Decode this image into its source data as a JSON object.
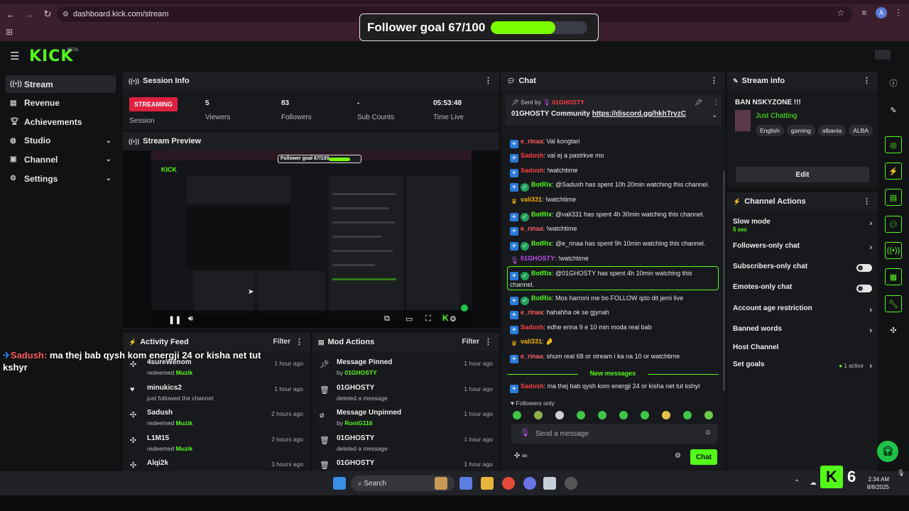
{
  "browser": {
    "url": "dashboard.kick.com/stream",
    "profile_initial": "A"
  },
  "goal": {
    "text": "Follower goal 67/100",
    "progress": 0.67
  },
  "brand": {
    "logo": "KICK",
    "badge": "BETA",
    "accent": "#53fc18"
  },
  "sidebar": {
    "items": [
      {
        "label": "Stream",
        "icon": "broadcast-icon",
        "active": true
      },
      {
        "label": "Revenue",
        "icon": "wallet-icon"
      },
      {
        "label": "Achievements",
        "icon": "trophy-icon"
      },
      {
        "label": "Studio",
        "icon": "studio-icon",
        "expandable": true
      },
      {
        "label": "Channel",
        "icon": "channel-icon",
        "expandable": true
      },
      {
        "label": "Settings",
        "icon": "gear-icon",
        "expandable": true
      }
    ]
  },
  "session": {
    "title": "Session Info",
    "status": "STREAMING",
    "status_label": "Session",
    "stats": [
      {
        "value": "5",
        "label": "Viewers"
      },
      {
        "value": "83",
        "label": "Followers"
      },
      {
        "value": "-",
        "label": "Sub Counts"
      },
      {
        "value": "05:53:48",
        "label": "Time Live"
      }
    ]
  },
  "preview": {
    "title": "Stream Preview",
    "mini_goal": "Follower goal 67/100"
  },
  "activity": {
    "title": "Activity Feed",
    "filter": "Filter",
    "items": [
      {
        "icon": "redeem-icon",
        "title": "4sureWenom",
        "sub": "redeemed ",
        "sub_hl": "Muzik",
        "time": "1 hour ago"
      },
      {
        "icon": "heart-icon",
        "title": "minukics2",
        "sub": "just followed the channel",
        "sub_hl": "",
        "time": "1 hour ago"
      },
      {
        "icon": "redeem-icon",
        "title": "Sadush",
        "sub": "redeemed ",
        "sub_hl": "Muzik",
        "time": "2 hours ago"
      },
      {
        "icon": "redeem-icon",
        "title": "L1M15",
        "sub": "redeemed ",
        "sub_hl": "Muzik",
        "time": "2 hours ago"
      },
      {
        "icon": "redeem-icon",
        "title": "Alqi2k",
        "sub": "",
        "sub_hl": "",
        "time": "3 hours ago"
      }
    ]
  },
  "modactions": {
    "title": "Mod Actions",
    "filter": "Filter",
    "items": [
      {
        "icon": "pin-icon",
        "title": "Message Pinned",
        "sub": "by ",
        "sub_hl": "01GHOSTY",
        "time": "1 hour ago"
      },
      {
        "icon": "trash-icon",
        "title": "01GHOSTY",
        "sub": "deleted a message",
        "sub_hl": "",
        "time": "1 hour ago"
      },
      {
        "icon": "unpin-icon",
        "title": "Message Unpinned",
        "sub": "by ",
        "sub_hl": "RoniG116",
        "time": "1 hour ago"
      },
      {
        "icon": "trash-icon",
        "title": "01GHOSTY",
        "sub": "deleted a message",
        "sub_hl": "",
        "time": "1 hour ago"
      },
      {
        "icon": "trash-icon",
        "title": "01GHOSTY",
        "sub": "",
        "sub_hl": "",
        "time": "1 hour ago"
      }
    ]
  },
  "chat": {
    "title": "Chat",
    "pinned_by_prefix": "Sent by",
    "pinned_by": "01GHOSTY",
    "pinned_text": "01GHOSTY Community ",
    "pinned_link": "https://discord.gg/hkhTrvzC",
    "messages": [
      {
        "badges": [
          "bot"
        ],
        "user": "e_rinaa",
        "color": "#ff5c5c",
        "text": "Val kongtari"
      },
      {
        "badges": [
          "bot"
        ],
        "user": "Sadush",
        "color": "#ff4040",
        "text": "val ej a pastrkve mo"
      },
      {
        "badges": [
          "bot"
        ],
        "user": "Sadush",
        "color": "#ff4040",
        "text": "!watchtime"
      },
      {
        "badges": [
          "bot",
          "ver"
        ],
        "user": "BotRix",
        "color": "#53fc18",
        "text": "@Sadush has spent 10h 20min watching this channel."
      },
      {
        "badges": [
          "crown"
        ],
        "user": "vali331",
        "color": "#f5b400",
        "text": "!watchtime"
      },
      {
        "badges": [
          "bot",
          "ver"
        ],
        "user": "BotRix",
        "color": "#53fc18",
        "text": "@vali331 has spent 4h 30min watching this channel."
      },
      {
        "badges": [
          "bot"
        ],
        "user": "e_rinaa",
        "color": "#ff5c5c",
        "text": "!watchtime"
      },
      {
        "badges": [
          "bot",
          "ver"
        ],
        "user": "BotRix",
        "color": "#53fc18",
        "text": "@e_rinaa has spent 9h 10min watching this channel."
      },
      {
        "badges": [
          "mic"
        ],
        "user": "01GHOSTY",
        "color": "#c04bf0",
        "text": "!watchtime"
      },
      {
        "badges": [
          "bot",
          "ver"
        ],
        "user": "BotRix",
        "color": "#53fc18",
        "text": "@01GHOSTY has spent 4h 10min watching this",
        "text2": "channel."
      },
      {
        "badges": [
          "bot",
          "ver"
        ],
        "user": "BotRix",
        "color": "#53fc18",
        "text": "Mos harroni me bo FOLLOW qdo dit jemi live"
      },
      {
        "badges": [
          "bot"
        ],
        "user": "e_rinaa",
        "color": "#ff5c5c",
        "text": "hahahha ok se gjynah"
      },
      {
        "badges": [
          "bot"
        ],
        "user": "Sadush",
        "color": "#ff4040",
        "text": "edhe erina 9 e 10 min moda real bab"
      },
      {
        "badges": [
          "crown"
        ],
        "user": "vali331",
        "color": "#f5b400",
        "text": "🤌"
      },
      {
        "badges": [
          "bot"
        ],
        "user": "e_rinaa",
        "color": "#ff5c5c",
        "text": "shum real 68 or stream i ka na 10 or watchtime"
      }
    ],
    "new_messages": "New messages",
    "last": {
      "badges": [
        "bot"
      ],
      "user": "Sadush",
      "color": "#ff4040",
      "text": "ma thej bab qysh kom energji 24 or kisha net tut kshyr"
    },
    "followers_only": "Followers only",
    "input_placeholder": "Send a message",
    "send_label": "Chat"
  },
  "streaminfo": {
    "title": "Stream info",
    "stream_title": "BAN NSKYZONE !!!",
    "category": "Just Chatting",
    "tags": [
      "English",
      "gaming",
      "albania",
      "ALBA"
    ],
    "edit_label": "Edit"
  },
  "channelactions": {
    "title": "Channel Actions",
    "items": [
      {
        "label": "Slow mode",
        "sub": "5 sec",
        "control": "chevron"
      },
      {
        "label": "Followers-only chat",
        "control": "chevron"
      },
      {
        "label": "Subscribers-only chat",
        "control": "toggle"
      },
      {
        "label": "Emotes-only chat",
        "control": "toggle"
      },
      {
        "label": "Account age restriction",
        "control": "chevron"
      },
      {
        "label": "Banned words",
        "control": "chevron"
      },
      {
        "label": "Host Channel",
        "control": "none"
      },
      {
        "label": "Set goals",
        "control": "chevron",
        "status": "1 active"
      }
    ]
  },
  "overlay_chat": {
    "user": "Sadush:",
    "text": " ma thej bab qysh kom energji 24 or kisha net tut kshyr"
  },
  "taskbar": {
    "search": "Search",
    "time": "2:34 AM",
    "date": "8/8/2025"
  },
  "kick_counter": {
    "logo": "K",
    "count": "6"
  }
}
